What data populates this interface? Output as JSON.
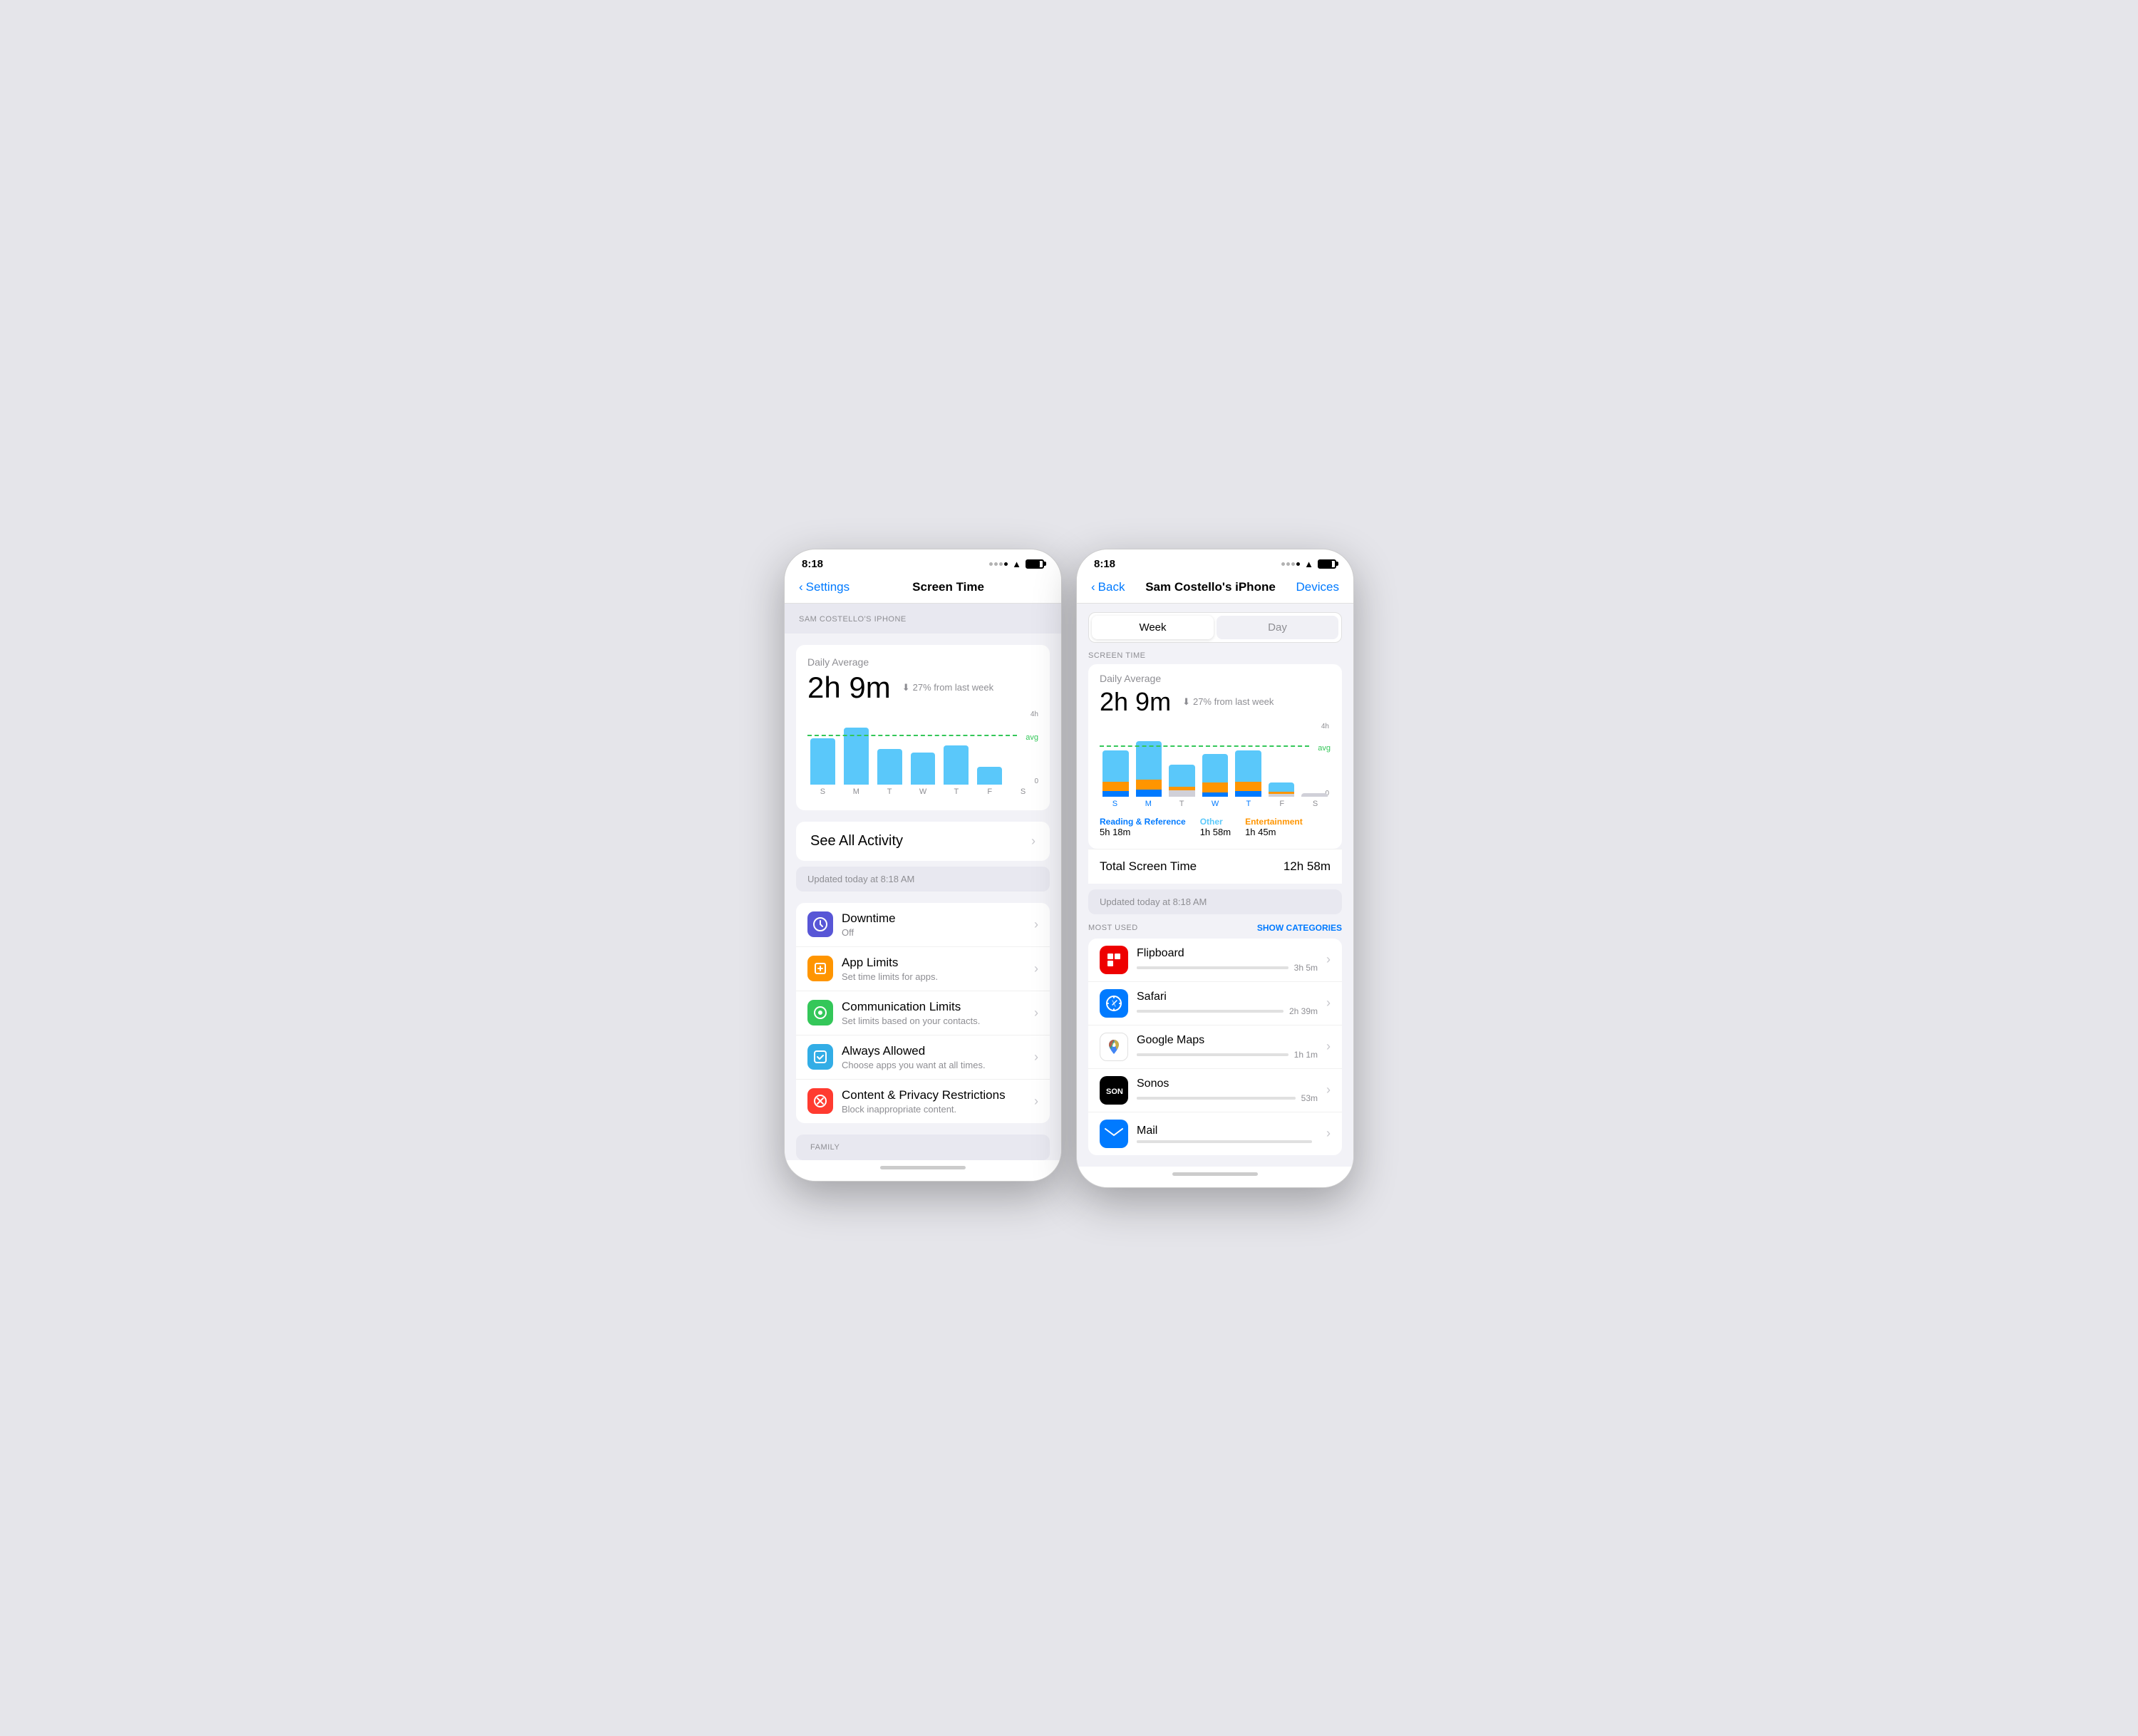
{
  "phone1": {
    "statusBar": {
      "time": "8:18",
      "battery": 80
    },
    "navBar": {
      "back": "Settings",
      "title": "Screen Time",
      "right": ""
    },
    "deviceSection": {
      "label": "SAM COSTELLO'S IPHONE"
    },
    "stats": {
      "dailyAverageLabel": "Daily Average",
      "time": "2h 9m",
      "changeIcon": "↓",
      "changeText": "27% from last week"
    },
    "chart": {
      "days": [
        "S",
        "M",
        "T",
        "W",
        "T",
        "F",
        "S"
      ],
      "bars": [
        65,
        80,
        50,
        45,
        55,
        25,
        0
      ],
      "yMax": "4h",
      "yMin": "0",
      "avgLabel": "avg"
    },
    "seeAll": {
      "label": "See All Activity",
      "chevron": "›"
    },
    "updated": {
      "text": "Updated today at 8:18 AM"
    },
    "settingsItems": [
      {
        "icon": "🌙",
        "iconClass": "icon-purple",
        "title": "Downtime",
        "subtitle": "Off"
      },
      {
        "icon": "⏱",
        "iconClass": "icon-orange",
        "title": "App Limits",
        "subtitle": "Set time limits for apps."
      },
      {
        "icon": "💬",
        "iconClass": "icon-green",
        "title": "Communication Limits",
        "subtitle": "Set limits based on your contacts."
      },
      {
        "icon": "✓",
        "iconClass": "icon-teal",
        "title": "Always Allowed",
        "subtitle": "Choose apps you want at all times."
      },
      {
        "icon": "🚫",
        "iconClass": "icon-red",
        "title": "Content & Privacy Restrictions",
        "subtitle": "Block inappropriate content."
      }
    ],
    "family": {
      "label": "FAMILY"
    }
  },
  "phone2": {
    "statusBar": {
      "time": "8:18"
    },
    "navBar": {
      "back": "Back",
      "title": "Sam Costello's iPhone",
      "right": "Devices"
    },
    "segments": {
      "week": "Week",
      "day": "Day",
      "activeIndex": 0
    },
    "screenTimeLabel": "SCREEN TIME",
    "stats": {
      "dailyAverageLabel": "Daily Average",
      "time": "2h 9m",
      "changeIcon": "↓",
      "changeText": "27% from last week"
    },
    "chart": {
      "days": [
        "S",
        "M",
        "T",
        "W",
        "T",
        "F",
        "S"
      ],
      "barsBlue": [
        55,
        60,
        35,
        50,
        55,
        10,
        0
      ],
      "barsOrange": [
        20,
        15,
        10,
        20,
        20,
        5,
        0
      ],
      "barsGray": [
        10,
        10,
        25,
        5,
        10,
        10,
        0
      ],
      "yMax": "4h",
      "yMin": "0",
      "avgLabel": "avg"
    },
    "legend": [
      {
        "label": "Reading & Reference",
        "color": "blue",
        "value": "5h 18m"
      },
      {
        "label": "Other",
        "color": "light-blue",
        "value": "1h 58m"
      },
      {
        "label": "Entertainment",
        "color": "orange",
        "value": "1h 45m"
      }
    ],
    "totalLabel": "Total Screen Time",
    "totalValue": "12h 58m",
    "updated": {
      "text": "Updated today at 8:18 AM"
    },
    "mostUsed": {
      "label": "MOST USED",
      "showCategories": "SHOW CATEGORIES"
    },
    "apps": [
      {
        "name": "Flipboard",
        "time": "3h 5m",
        "barWidth": 85,
        "iconType": "flipboard"
      },
      {
        "name": "Safari",
        "time": "2h 39m",
        "barWidth": 70,
        "iconType": "safari"
      },
      {
        "name": "Google Maps",
        "time": "1h 1m",
        "barWidth": 40,
        "iconType": "googlemaps"
      },
      {
        "name": "Sonos",
        "time": "53m",
        "barWidth": 25,
        "iconType": "sonos"
      },
      {
        "name": "Mail",
        "time": "",
        "barWidth": 20,
        "iconType": "mail"
      }
    ]
  }
}
